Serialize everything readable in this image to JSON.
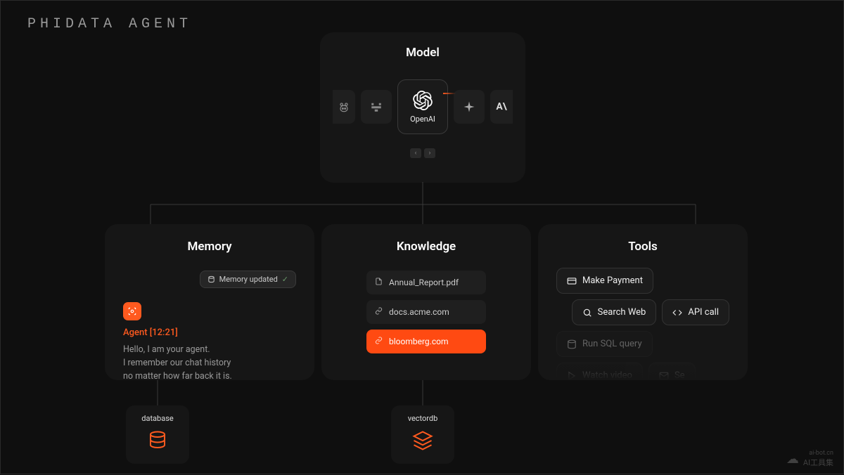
{
  "header": {
    "title": "PHIDATA AGENT"
  },
  "model": {
    "title": "Model",
    "items": [
      "ollama",
      "mistral",
      "openai",
      "gemini",
      "anthropic"
    ],
    "selected_label": "OpenAI",
    "anthropic_glyph": "A\\"
  },
  "memory": {
    "title": "Memory",
    "badge": "Memory updated",
    "agent_label": "Agent [12:21]",
    "message_line1": "Hello, I am your agent.",
    "message_line2": "I remember our chat history",
    "message_line3": "no matter how far back it is."
  },
  "knowledge": {
    "title": "Knowledge",
    "items": [
      {
        "icon": "file",
        "label": "Annual_Report.pdf",
        "active": false
      },
      {
        "icon": "link",
        "label": "docs.acme.com",
        "active": false
      },
      {
        "icon": "link",
        "label": "bloomberg.com",
        "active": true
      }
    ]
  },
  "tools": {
    "title": "Tools",
    "items": [
      {
        "icon": "card",
        "label": "Make Payment",
        "dim": false
      },
      {
        "icon": "search",
        "label": "Search Web",
        "dim": false
      },
      {
        "icon": "code",
        "label": "API call",
        "dim": false
      },
      {
        "icon": "db",
        "label": "Run SQL query",
        "dim": true
      },
      {
        "icon": "play",
        "label": "Watch video",
        "dim": true
      },
      {
        "icon": "mail",
        "label": "Se",
        "dim": true
      }
    ]
  },
  "subboxes": {
    "database": "database",
    "vectordb": "vectordb"
  },
  "watermark": {
    "small": "ai-bot.cn",
    "large": "AI工具集"
  }
}
